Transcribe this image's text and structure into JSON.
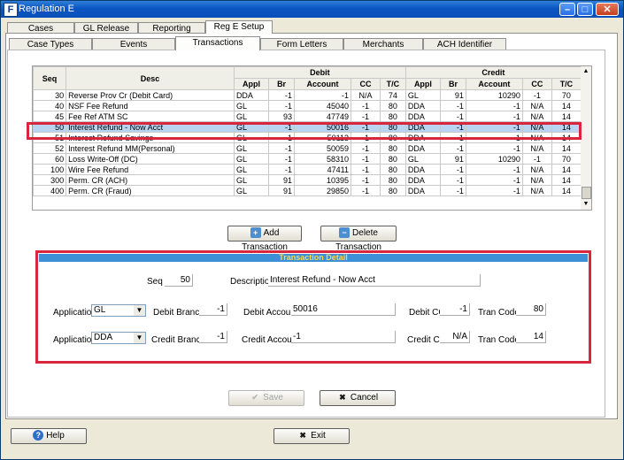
{
  "window": {
    "title": "Regulation E",
    "app_icon": "F"
  },
  "main_tabs": [
    "Cases",
    "GL Release",
    "Reporting",
    "Reg E Setup"
  ],
  "sub_tabs": [
    "Case Types",
    "Events",
    "Transactions",
    "Form Letters",
    "Merchants",
    "ACH Identifier"
  ],
  "grid": {
    "group_headers": {
      "seq": "Seq",
      "desc": "Desc",
      "debit": "Debit",
      "credit": "Credit"
    },
    "col_headers": [
      "Appl",
      "Br",
      "Account",
      "CC",
      "T/C",
      "Appl",
      "Br",
      "Account",
      "CC",
      "T/C"
    ],
    "rows": [
      [
        "30",
        "Reverse Prov Cr (Debit Card)",
        "DDA",
        "-1",
        "-1",
        "N/A",
        "74",
        "GL",
        "91",
        "10290",
        "-1",
        "70"
      ],
      [
        "40",
        "NSF Fee Refund",
        "GL",
        "-1",
        "45040",
        "-1",
        "80",
        "DDA",
        "-1",
        "-1",
        "N/A",
        "14"
      ],
      [
        "45",
        "Fee Ref ATM SC",
        "GL",
        "93",
        "47749",
        "-1",
        "80",
        "DDA",
        "-1",
        "-1",
        "N/A",
        "14"
      ],
      [
        "50",
        "Interest Refund - Now Acct",
        "GL",
        "-1",
        "50016",
        "-1",
        "80",
        "DDA",
        "-1",
        "-1",
        "N/A",
        "14"
      ],
      [
        "51",
        "Interest Refund Savings",
        "GL",
        "-1",
        "50113",
        "-1",
        "80",
        "DDA",
        "-1",
        "-1",
        "N/A",
        "14"
      ],
      [
        "52",
        "Interest Refund MM(Personal)",
        "GL",
        "-1",
        "50059",
        "-1",
        "80",
        "DDA",
        "-1",
        "-1",
        "N/A",
        "14"
      ],
      [
        "60",
        "Loss Write-Off (DC)",
        "GL",
        "-1",
        "58310",
        "-1",
        "80",
        "GL",
        "91",
        "10290",
        "-1",
        "70"
      ],
      [
        "100",
        "Wire Fee Refund",
        "GL",
        "-1",
        "47411",
        "-1",
        "80",
        "DDA",
        "-1",
        "-1",
        "N/A",
        "14"
      ],
      [
        "300",
        "Perm. CR (ACH)",
        "GL",
        "91",
        "10395",
        "-1",
        "80",
        "DDA",
        "-1",
        "-1",
        "N/A",
        "14"
      ],
      [
        "400",
        "Perm. CR (Fraud)",
        "GL",
        "91",
        "29850",
        "-1",
        "80",
        "DDA",
        "-1",
        "-1",
        "N/A",
        "14"
      ]
    ],
    "selected_row": 3
  },
  "buttons": {
    "add": "Add Transaction",
    "delete": "Delete Transaction",
    "save": "Save",
    "cancel": "Cancel",
    "help": "Help",
    "exit": "Exit"
  },
  "detail": {
    "header": "Transaction Detail",
    "seq_label": "Seq",
    "seq": "50",
    "desc_label": "Description",
    "desc": "Interest Refund - Now Acct",
    "application_label": "Application",
    "debit_appl": "GL",
    "debit_branch_label": "Debit Branch",
    "debit_branch": "-1",
    "debit_account_label": "Debit Account",
    "debit_account": "50016",
    "debit_cc_label": "Debit CC",
    "debit_cc": "-1",
    "tran_code_label": "Tran Code",
    "debit_tran_code": "80",
    "credit_appl": "DDA",
    "credit_branch_label": "Credit Branch",
    "credit_branch": "-1",
    "credit_account_label": "Credit Account",
    "credit_account": "-1",
    "credit_cc_label": "Credit CC",
    "credit_cc": "N/A",
    "credit_tran_code": "14"
  },
  "colors": {
    "highlight": "#d8263d",
    "selected_row": "#b8d4f0",
    "detail_header_bg": "#3d8fd6",
    "detail_header_text": "#ffd84a"
  }
}
